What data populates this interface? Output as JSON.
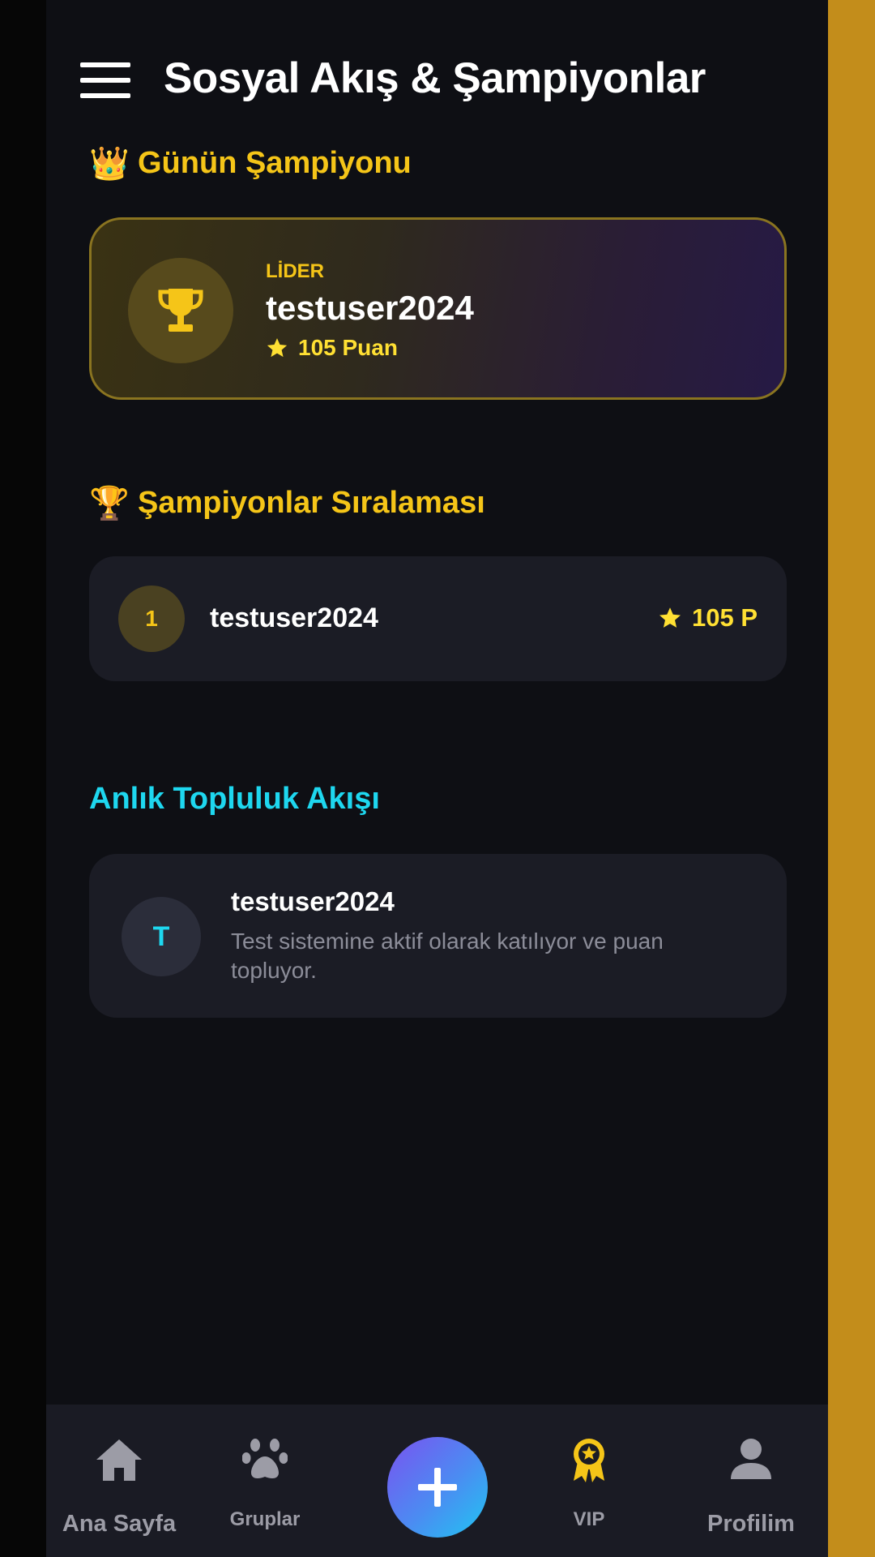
{
  "header": {
    "title": "Sosyal Akış & Şampiyonlar"
  },
  "champion_section": {
    "emoji": "👑",
    "title": "Günün Şampiyonu",
    "card": {
      "label": "LİDER",
      "name": "testuser2024",
      "points": "105 Puan"
    }
  },
  "ranking_section": {
    "emoji": "🏆",
    "title": "Şampiyonlar Sıralaması",
    "items": [
      {
        "rank": "1",
        "name": "testuser2024",
        "points": "105 P"
      }
    ]
  },
  "feed_section": {
    "title": "Anlık Topluluk Akışı",
    "items": [
      {
        "initial": "T",
        "user": "testuser2024",
        "text": "Test sistemine aktif olarak katılıyor ve puan topluyor."
      }
    ]
  },
  "bottom_nav": {
    "home": "Ana Sayfa",
    "groups": "Gruplar",
    "vip": "VIP",
    "profile": "Profilim"
  },
  "colors": {
    "accent_gold": "#f5c518",
    "accent_cyan": "#1ed7ef",
    "background": "#0e0f14",
    "card": "#1b1c25"
  },
  "icons": [
    "menu-icon",
    "crown-icon",
    "trophy-icon",
    "star-icon",
    "home-icon",
    "paw-icon",
    "plus-icon",
    "vip-badge-icon",
    "user-icon"
  ]
}
